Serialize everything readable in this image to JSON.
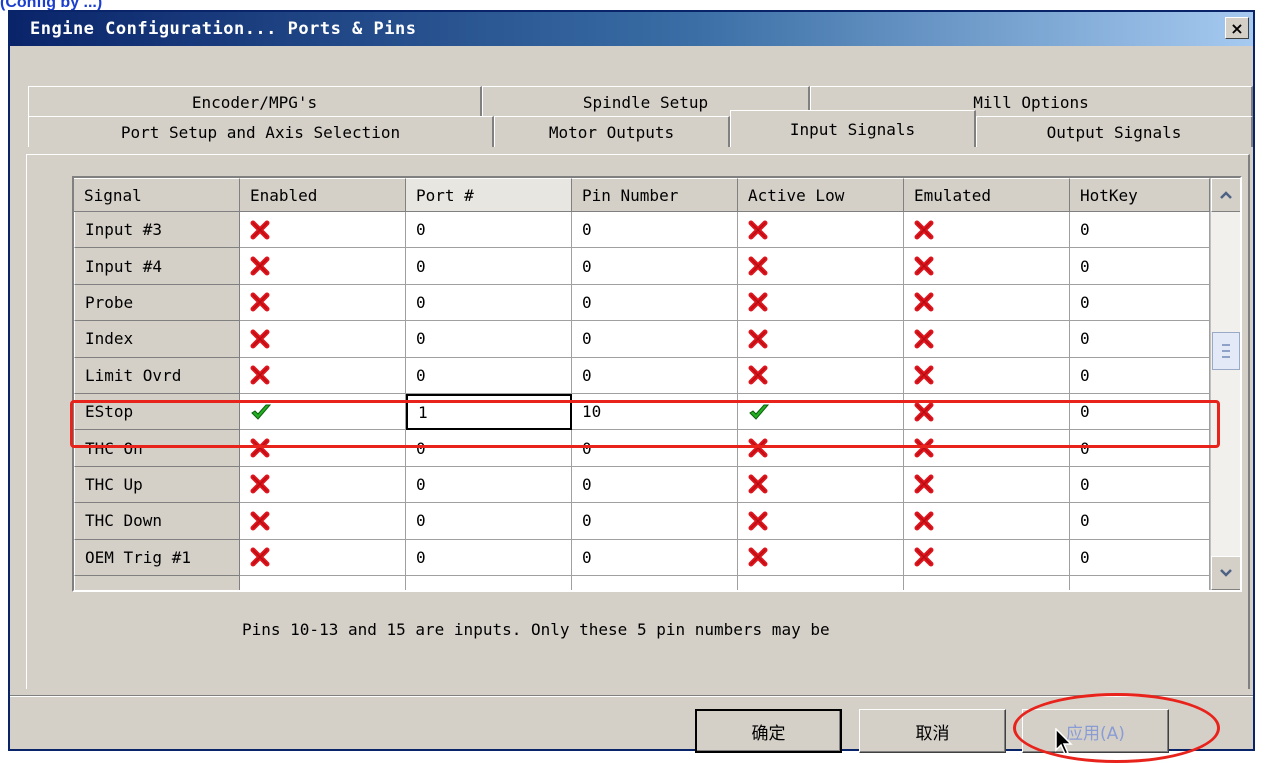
{
  "top_caption": "(Config by ...)",
  "window": {
    "title": "Engine Configuration... Ports & Pins",
    "close_label": "×"
  },
  "tabs_row1": [
    {
      "label": "Encoder/MPG's"
    },
    {
      "label": "Spindle Setup"
    },
    {
      "label": "Mill Options"
    }
  ],
  "tabs_row2": [
    {
      "label": "Port Setup and Axis Selection"
    },
    {
      "label": "Motor Outputs"
    },
    {
      "label": "Input Signals",
      "active": true
    },
    {
      "label": "Output Signals"
    }
  ],
  "grid": {
    "columns": [
      "Signal",
      "Enabled",
      "Port #",
      "Pin Number",
      "Active Low",
      "Emulated",
      "HotKey"
    ],
    "rows": [
      {
        "signal": "Input #3",
        "enabled": "cross",
        "port": "0",
        "pin": "0",
        "active_low": "cross",
        "emulated": "cross",
        "hotkey": "0"
      },
      {
        "signal": "Input #4",
        "enabled": "cross",
        "port": "0",
        "pin": "0",
        "active_low": "cross",
        "emulated": "cross",
        "hotkey": "0"
      },
      {
        "signal": "Probe",
        "enabled": "cross",
        "port": "0",
        "pin": "0",
        "active_low": "cross",
        "emulated": "cross",
        "hotkey": "0"
      },
      {
        "signal": "Index",
        "enabled": "cross",
        "port": "0",
        "pin": "0",
        "active_low": "cross",
        "emulated": "cross",
        "hotkey": "0"
      },
      {
        "signal": "Limit Ovrd",
        "enabled": "cross",
        "port": "0",
        "pin": "0",
        "active_low": "cross",
        "emulated": "cross",
        "hotkey": "0"
      },
      {
        "signal": "EStop",
        "enabled": "check",
        "port": "1",
        "pin": "10",
        "active_low": "check",
        "emulated": "cross",
        "hotkey": "0"
      },
      {
        "signal": "THC On",
        "enabled": "cross",
        "port": "0",
        "pin": "0",
        "active_low": "cross",
        "emulated": "cross",
        "hotkey": "0"
      },
      {
        "signal": "THC Up",
        "enabled": "cross",
        "port": "0",
        "pin": "0",
        "active_low": "cross",
        "emulated": "cross",
        "hotkey": "0"
      },
      {
        "signal": "THC Down",
        "enabled": "cross",
        "port": "0",
        "pin": "0",
        "active_low": "cross",
        "emulated": "cross",
        "hotkey": "0"
      },
      {
        "signal": "OEM Trig #1",
        "enabled": "cross",
        "port": "0",
        "pin": "0",
        "active_low": "cross",
        "emulated": "cross",
        "hotkey": "0"
      }
    ]
  },
  "help_text": "Pins 10-13 and 15 are inputs. Only these 5 pin numbers may be",
  "buttons": {
    "ok": "确定",
    "cancel": "取消",
    "apply": "应用(A)"
  },
  "colors": {
    "highlight": "#e8231c",
    "titlebar": "#0a246a",
    "check": "#22b022",
    "cross": "#e0141c"
  }
}
